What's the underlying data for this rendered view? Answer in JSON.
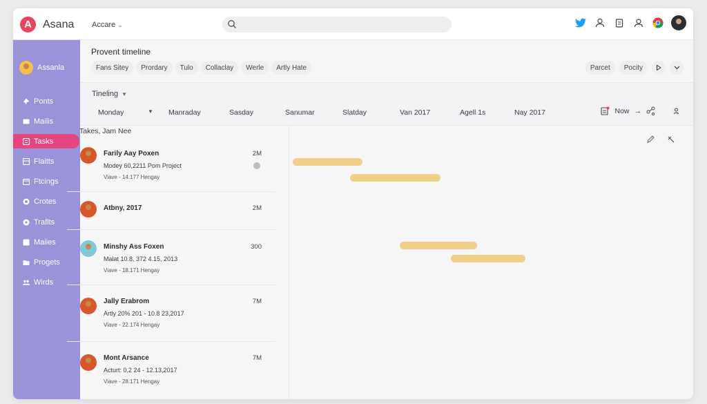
{
  "app": {
    "logo_letter": "A",
    "name": "Asana",
    "workspace": "Accare",
    "workspace_chevron": "⌄"
  },
  "topbar": {
    "search_placeholder": "",
    "icons": [
      "twitter-icon",
      "user-icon",
      "clipboard-icon",
      "people-icon",
      "chrome-icon",
      "profile-avatar"
    ]
  },
  "sidebar": {
    "user_name": "Assanla",
    "items": [
      {
        "label": "Ponts",
        "icon": "pin-icon"
      },
      {
        "label": "Mailis",
        "icon": "mail-icon"
      },
      {
        "label": "Tasks",
        "icon": "tasks-icon",
        "active": true
      },
      {
        "label": "Flaitts",
        "icon": "board-icon"
      },
      {
        "label": "Ftcings",
        "icon": "calendar-icon"
      },
      {
        "label": "Crotes",
        "icon": "circle-icon"
      },
      {
        "label": "Trafits",
        "icon": "gear-icon"
      },
      {
        "label": "Maiies",
        "icon": "grid-icon"
      },
      {
        "label": "Progets",
        "icon": "folder-icon"
      },
      {
        "label": "Wirds",
        "icon": "team-icon"
      }
    ]
  },
  "header": {
    "title": "Provent timeline",
    "tabs": [
      "Fans Sitey",
      "Prordary",
      "Tulo",
      "Collaclay",
      "Werle",
      "Artly Hate"
    ],
    "buttons": [
      "Parcet",
      "Pocity"
    ]
  },
  "timeline": {
    "label": "Tineling",
    "dates": [
      "Monday",
      "Manraday",
      "Sasday",
      "Sanumar",
      "Slatday",
      "Van 2017",
      "Agell 1s",
      "Nay 2017"
    ],
    "now_label": "Now"
  },
  "tasks": {
    "caption": "Takes, Jam Nee",
    "items": [
      {
        "name": "Farily Aay Poxen",
        "detail": "Modey 60,2211 Pom Project",
        "meta": "Viave - 14.177 Hengay",
        "duration": "2M"
      },
      {
        "name": "Atbny, 2017",
        "detail": "",
        "meta": "",
        "duration": "2M"
      },
      {
        "name": "Minshy Ass Foxen",
        "detail": "Malat 10.8, 372 4.15, 2013",
        "meta": "Viave - 18.171 Hengay",
        "duration": "300"
      },
      {
        "name": "Jally Erabrom",
        "detail": "Artly 20% 201 - 10.8 23,2017",
        "meta": "Viave - 22.174 Hengay",
        "duration": "7M"
      },
      {
        "name": "Mont Arsance",
        "detail": "Acturt: 0,2 24 - 12.13,2017",
        "meta": "Viave - 28.171 Hengay",
        "duration": "7M"
      }
    ]
  },
  "colors": {
    "sidebar": "#9b93d9",
    "active": "#e5467e",
    "brand": "#e8445a",
    "bar": "#f0cf88"
  }
}
